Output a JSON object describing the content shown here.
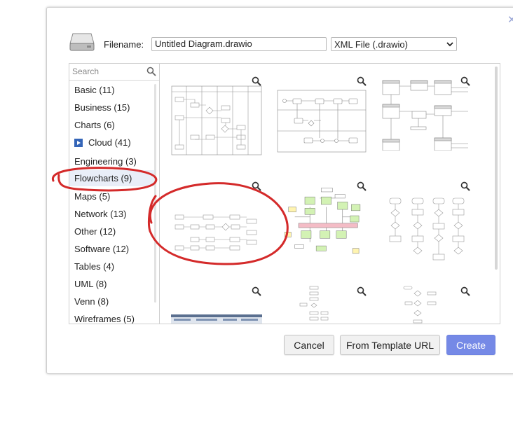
{
  "header": {
    "filename_label": "Filename:",
    "filename_value": "Untitled Diagram.drawio",
    "format_selected": "XML File (.drawio)"
  },
  "sidebar": {
    "search_placeholder": "Search",
    "categories": [
      {
        "label": "Basic (11)"
      },
      {
        "label": "Business (15)"
      },
      {
        "label": "Charts (6)"
      },
      {
        "label": "Cloud (41)"
      },
      {
        "label": "Engineering (3)"
      },
      {
        "label": "Flowcharts (9)"
      },
      {
        "label": "Maps (5)"
      },
      {
        "label": "Network (13)"
      },
      {
        "label": "Other (12)"
      },
      {
        "label": "Software (12)"
      },
      {
        "label": "Tables (4)"
      },
      {
        "label": "UML (8)"
      },
      {
        "label": "Venn (8)"
      },
      {
        "label": "Wireframes (5)"
      }
    ],
    "selected": "Flowcharts (9)"
  },
  "buttons": {
    "cancel": "Cancel",
    "template_url": "From Template URL",
    "create": "Create"
  },
  "colors": {
    "primary": "#7589e6",
    "annotation": "#d42a2a",
    "selection_bg": "#e9eef8",
    "cloud_icon": "#3465b8"
  }
}
